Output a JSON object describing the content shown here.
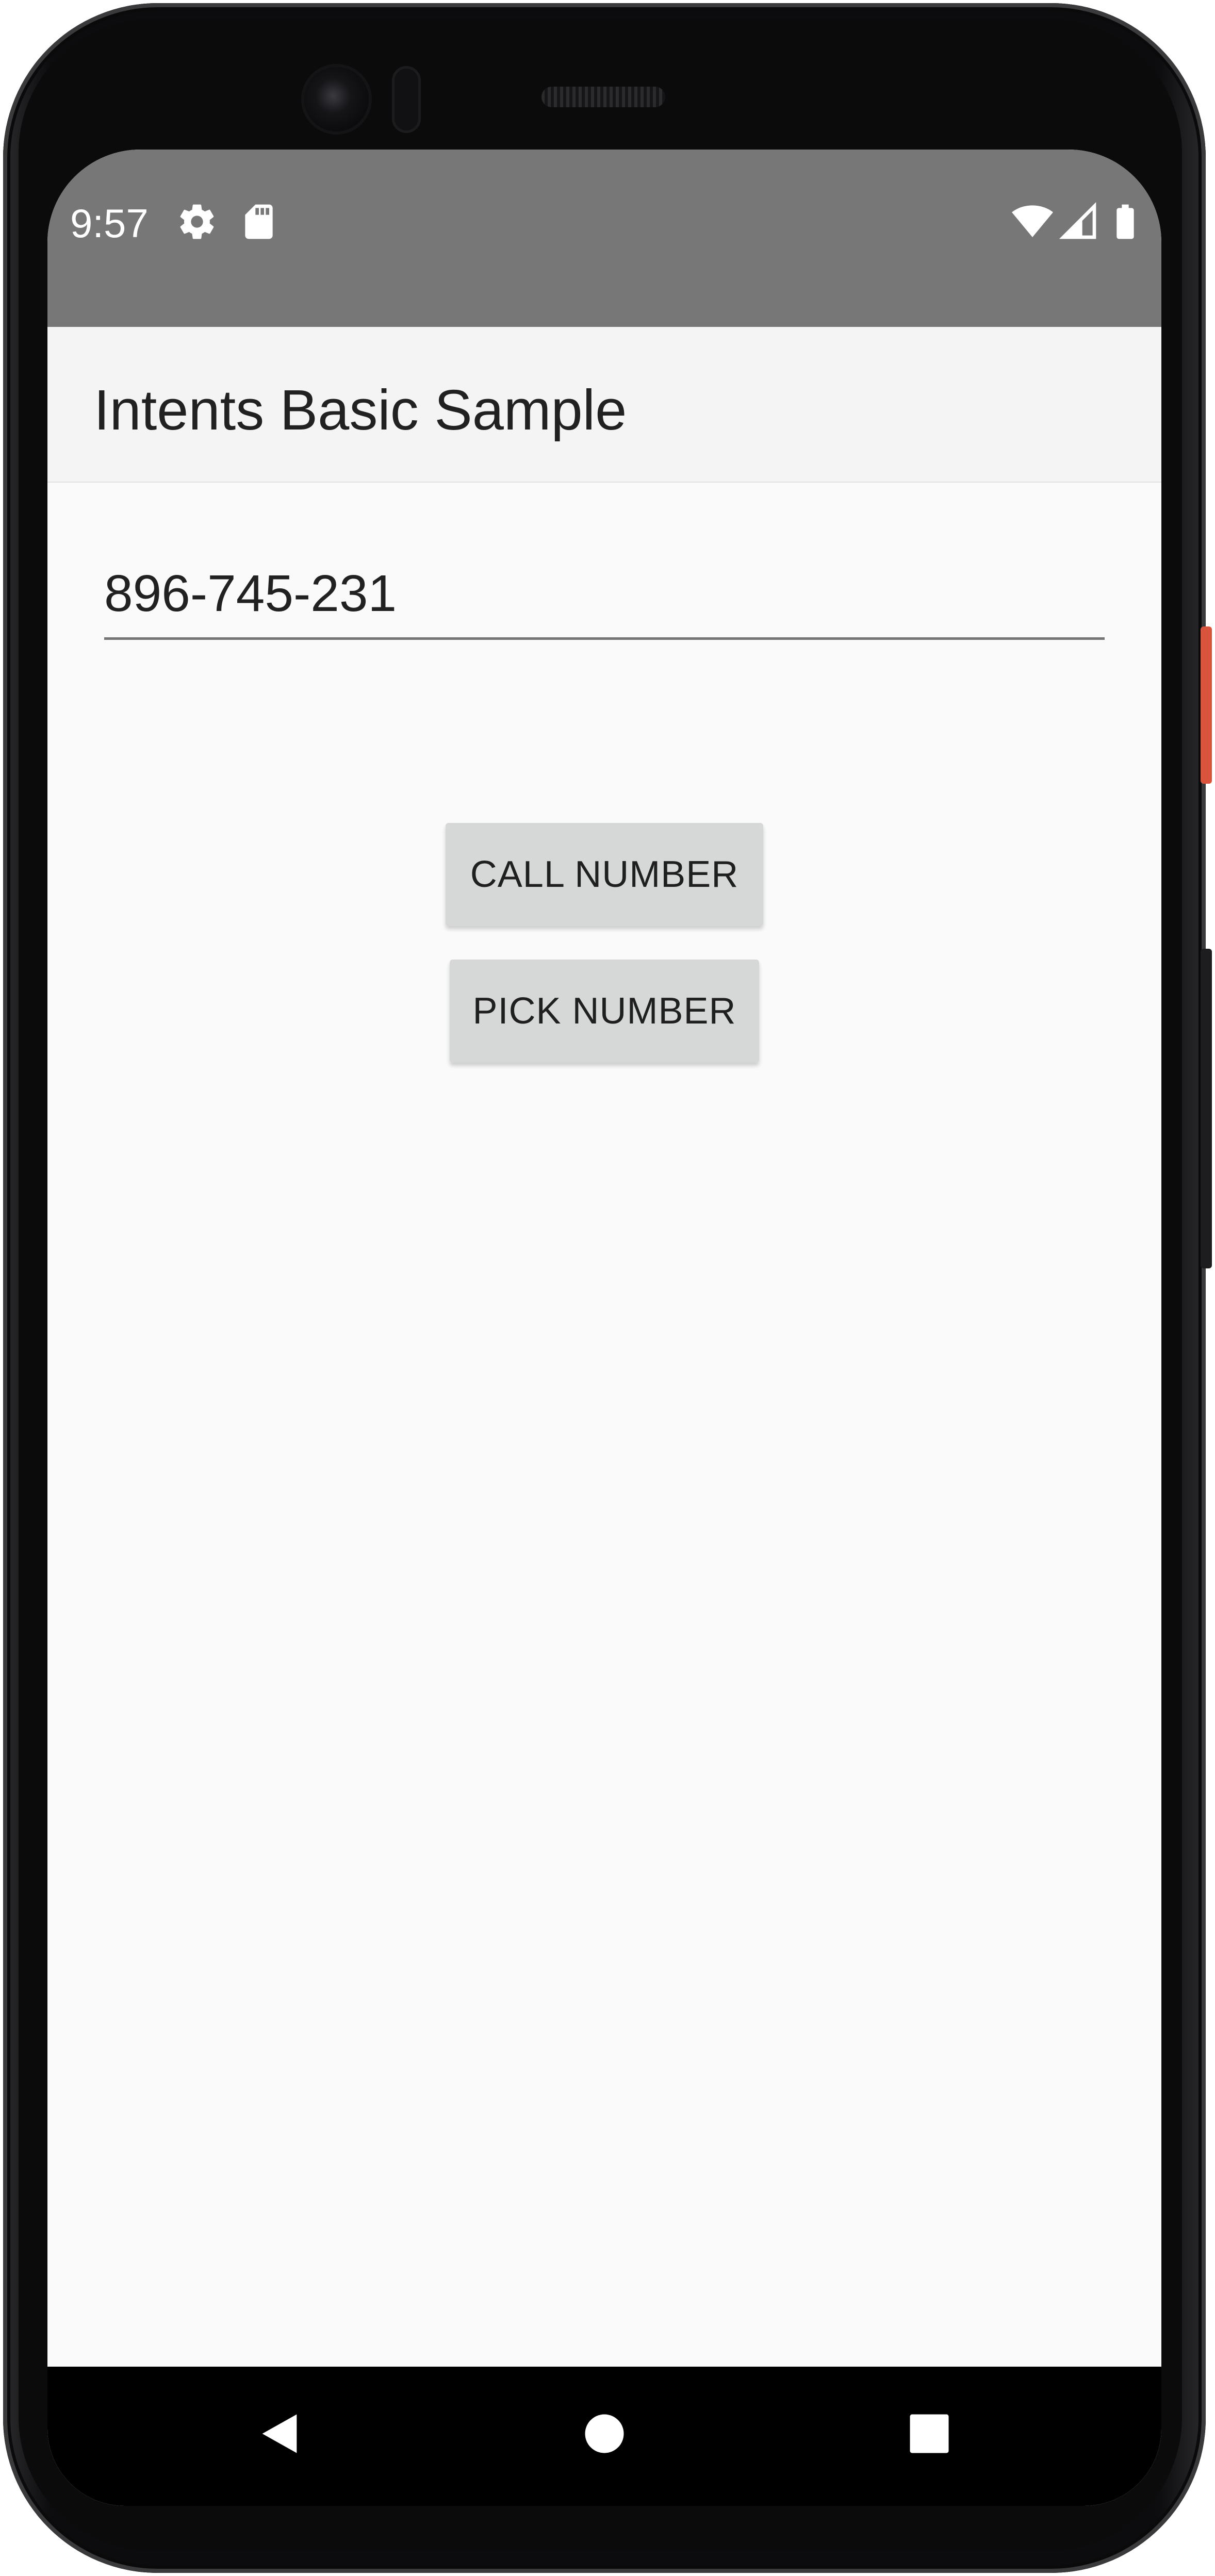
{
  "status_bar": {
    "time": "9:57",
    "left_icons": [
      "gear-icon",
      "sd-card-icon"
    ],
    "right_icons": [
      "wifi-icon",
      "cell-signal-icon",
      "battery-icon"
    ]
  },
  "app_bar": {
    "title": "Intents Basic Sample"
  },
  "main": {
    "phone_field_value": "896-745-231",
    "call_button_label": "CALL NUMBER",
    "pick_button_label": "PICK NUMBER"
  },
  "navigation_bar": {
    "buttons": [
      "back-icon",
      "home-icon",
      "recents-icon"
    ]
  },
  "colors": {
    "status_bar": "#777777",
    "app_bar": "#f4f4f4",
    "background": "#fafafa",
    "button": "#d6d7d7",
    "nav_bar": "#000000",
    "side_button": "#d8543c"
  }
}
